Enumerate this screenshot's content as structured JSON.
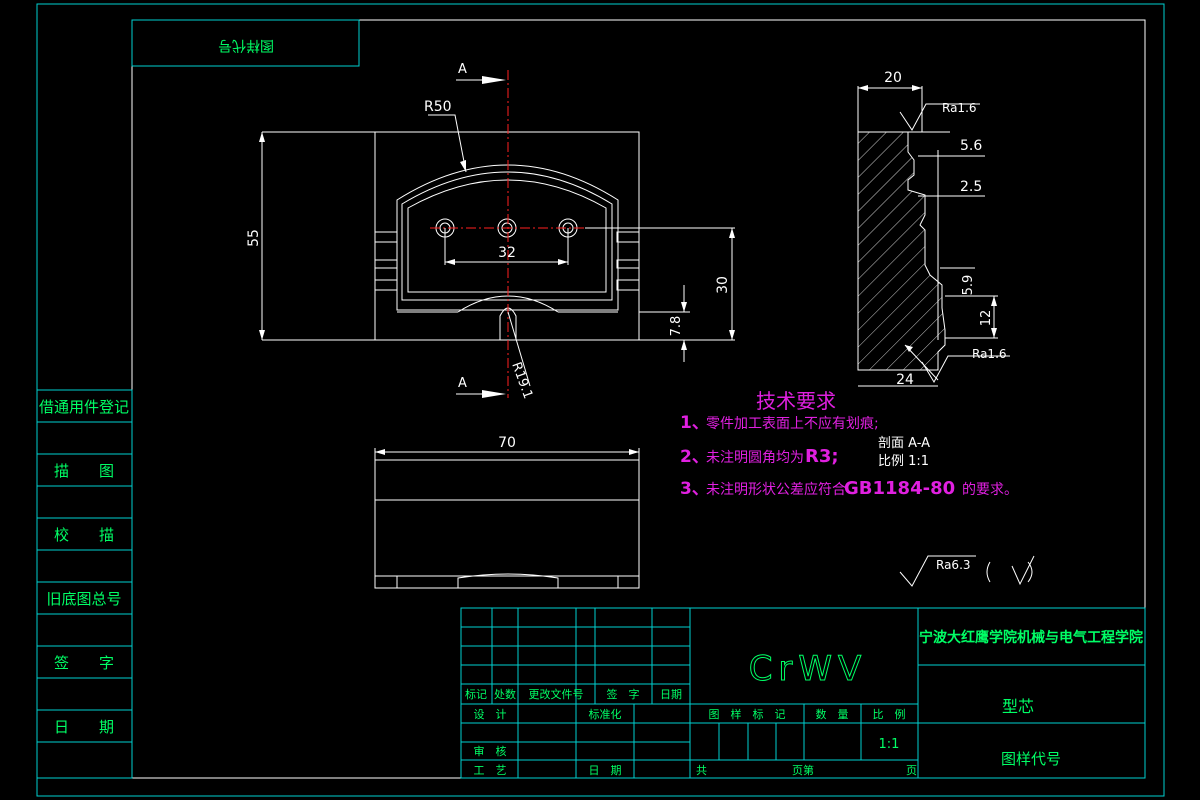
{
  "colors": {
    "frame": "#00d0d0",
    "outline": "#ffffff",
    "label": "#00ff66",
    "dim": "#ffffff",
    "center": "#ff2020",
    "tech": "#e020e0"
  },
  "header_box": {
    "text": "图样代号"
  },
  "side_table": [
    "借通用件登记",
    "描　　图",
    "校　　描",
    "旧底图总号",
    "签　　字",
    "日　　期"
  ],
  "section": {
    "mark": "A"
  },
  "dims": {
    "r50": "R50",
    "h55": "55",
    "w32": "32",
    "h30": "30",
    "h78": "7.8",
    "r191": "R19.1",
    "w70": "70",
    "s20": "20",
    "s56": "5.6",
    "s25": "2.5",
    "s59": "5.9",
    "s12": "12",
    "s24": "24",
    "ra1": "Ra1.6",
    "ra2": "Ra1.6"
  },
  "section_label": {
    "line1": "剖面 A-A",
    "line2": "比例 1:1"
  },
  "tech": {
    "title": "技术要求",
    "items": [
      {
        "num": "1、",
        "text": "零件加工表面上不应有划痕;"
      },
      {
        "num": "2、",
        "text": "未注明圆角均为",
        "strong": "R3;"
      },
      {
        "num": "3、",
        "text": "未注明形状公差应符合",
        "strong": "GB1184-80",
        "tail": "的要求。"
      }
    ]
  },
  "roughness": {
    "value": "Ra6.3"
  },
  "title_block": {
    "material": "CrWV",
    "school": "宁波大红鹰学院机械与电气工程学院",
    "part_name": "型芯",
    "drawing_code": "图样代号",
    "scale": "1:1",
    "rev_headers": [
      "标记",
      "处数",
      "更改文件号",
      "签　字",
      "日期"
    ],
    "design": "设　计",
    "standard": "标准化",
    "check": "审　核",
    "process": "工　艺",
    "date": "日　期",
    "meta_headers": [
      "图　样　标　记",
      "数　量",
      "比　例"
    ],
    "total": "共",
    "sheet_unit": "页第",
    "sheet_end": "页"
  }
}
